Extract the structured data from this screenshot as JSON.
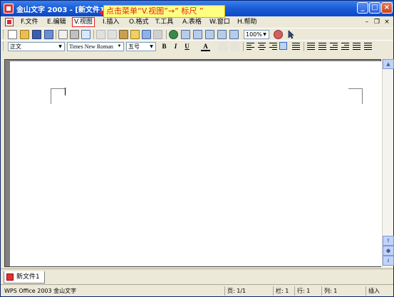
{
  "window": {
    "title": "金山文字 2003 - [新文件1]",
    "controls": [
      "minimize-button",
      "maximize-button",
      "close-button"
    ]
  },
  "callout": {
    "text": "点击菜单“V.视图”→“ 标尺 ”"
  },
  "menu": {
    "items": [
      {
        "label": "F.文件"
      },
      {
        "label": "E.编辑"
      },
      {
        "label": "V.视图",
        "highlighted": true
      },
      {
        "label": "I.插入"
      },
      {
        "label": "O.格式"
      },
      {
        "label": "T.工具"
      },
      {
        "label": "A.表格"
      },
      {
        "label": "W.窗口"
      },
      {
        "label": "H.帮助"
      }
    ],
    "mdi_controls": [
      "minimize",
      "restore",
      "close"
    ]
  },
  "toolbar_standard": {
    "zoom": "100%"
  },
  "toolbar_format": {
    "style": "正文",
    "font": "Times New Roman",
    "size": "五号",
    "bold": "B",
    "italic": "I",
    "underline": "U",
    "font_color": "A"
  },
  "doc_tabs": {
    "items": [
      {
        "label": "新文件1"
      }
    ]
  },
  "status": {
    "app": "WPS Office 2003 金山文字",
    "page": "页: 1/1",
    "column": "栏: 1",
    "line": "行: 1",
    "col": "列: 1",
    "mode": "插入"
  },
  "colors": {
    "titlebar": "#0a48c8",
    "callout_bg": "#ffff80",
    "callout_text": "#e02020",
    "highlight_border": "#dd2222"
  }
}
